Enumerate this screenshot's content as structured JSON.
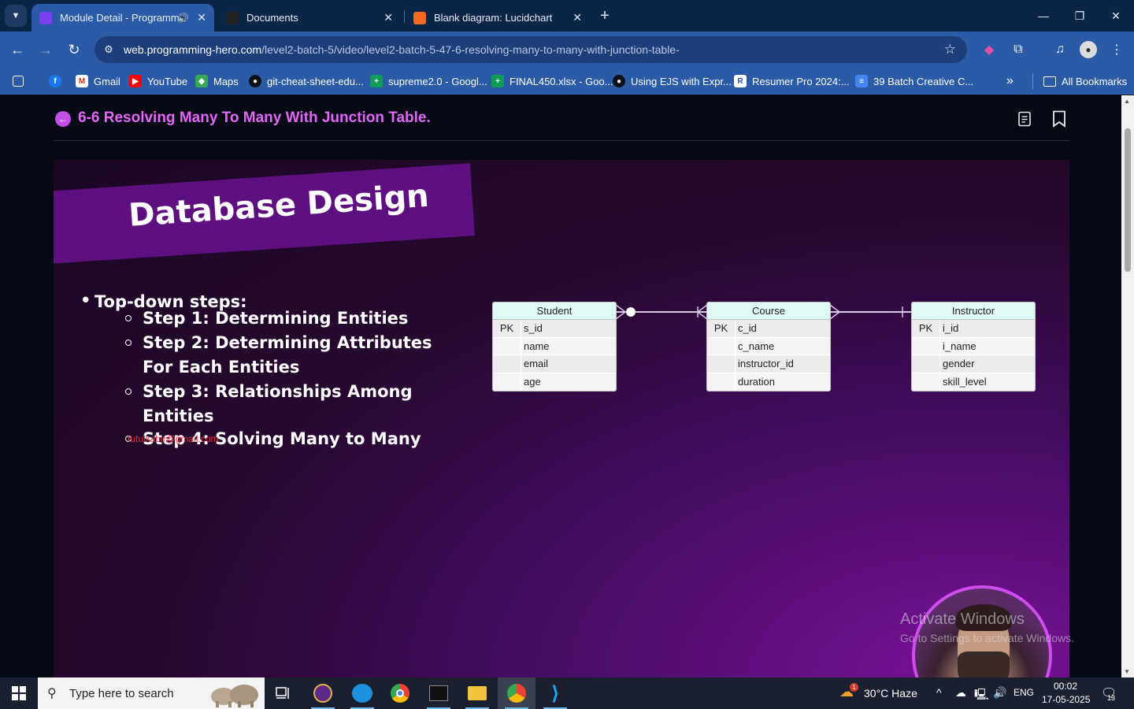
{
  "browser": {
    "tabs": [
      {
        "title": "Module Detail - Programmi",
        "active": true,
        "audio": true
      },
      {
        "title": "Documents",
        "active": false
      },
      {
        "title": "Blank diagram: Lucidchart",
        "active": false
      }
    ],
    "url_host": "web.programming-hero.com",
    "url_path": "/level2-batch-5/video/level2-batch-5-47-6-resolving-many-to-many-with-junction-table-",
    "bookmarks": [
      {
        "label": "Gmail",
        "icon": "gmail-icon"
      },
      {
        "label": "YouTube",
        "icon": "youtube-icon"
      },
      {
        "label": "Maps",
        "icon": "maps-icon"
      },
      {
        "label": "git-cheat-sheet-edu...",
        "icon": "github-icon"
      },
      {
        "label": "supreme2.0 - Googl...",
        "icon": "sheets-icon"
      },
      {
        "label": "FINAL450.xlsx - Goo...",
        "icon": "sheets-icon"
      },
      {
        "label": "Using EJS with Expr...",
        "icon": "github-icon"
      },
      {
        "label": "Resumer Pro 2024:...",
        "icon": "resumer-icon"
      },
      {
        "label": "39 Batch Creative C...",
        "icon": "docs-icon"
      }
    ],
    "all_bookmarks": "All Bookmarks"
  },
  "module": {
    "title": "6-6 Resolving Many To Many With Junction Table."
  },
  "slide": {
    "title": "Database Design",
    "main_bullet": "Top-down steps:",
    "steps": [
      "Step 1: Determining Entities",
      "Step 2: Determining Attributes For Each Entities",
      "Step 3: Relationships Among Entities",
      "Step 4: Solving Many to Many"
    ],
    "email_watermark": "tutulkabir@gmail.com",
    "tables": [
      {
        "name": "Student",
        "rows": [
          {
            "key": "PK",
            "field": "s_id"
          },
          {
            "key": "",
            "field": "name"
          },
          {
            "key": "",
            "field": "email"
          },
          {
            "key": "",
            "field": "age"
          }
        ]
      },
      {
        "name": "Course",
        "rows": [
          {
            "key": "PK",
            "field": "c_id"
          },
          {
            "key": "",
            "field": "c_name"
          },
          {
            "key": "",
            "field": "instructor_id"
          },
          {
            "key": "",
            "field": "duration"
          }
        ]
      },
      {
        "name": "Instructor",
        "rows": [
          {
            "key": "PK",
            "field": "i_id"
          },
          {
            "key": "",
            "field": "i_name"
          },
          {
            "key": "",
            "field": "gender"
          },
          {
            "key": "",
            "field": "skill_level"
          }
        ]
      }
    ]
  },
  "windows_watermark": {
    "line1": "Activate Windows",
    "line2": "Go to Settings to activate Windows."
  },
  "taskbar": {
    "search_placeholder": "Type here to search",
    "weather": "30°C  Haze",
    "weather_badge": "1",
    "language": "ENG",
    "time": "00:02",
    "date": "17-05-2025",
    "notifications": "13"
  },
  "colors": {
    "accent": "#e266f7",
    "browser_bar": "#2b5aa7",
    "tab_strip": "#0b2547"
  }
}
